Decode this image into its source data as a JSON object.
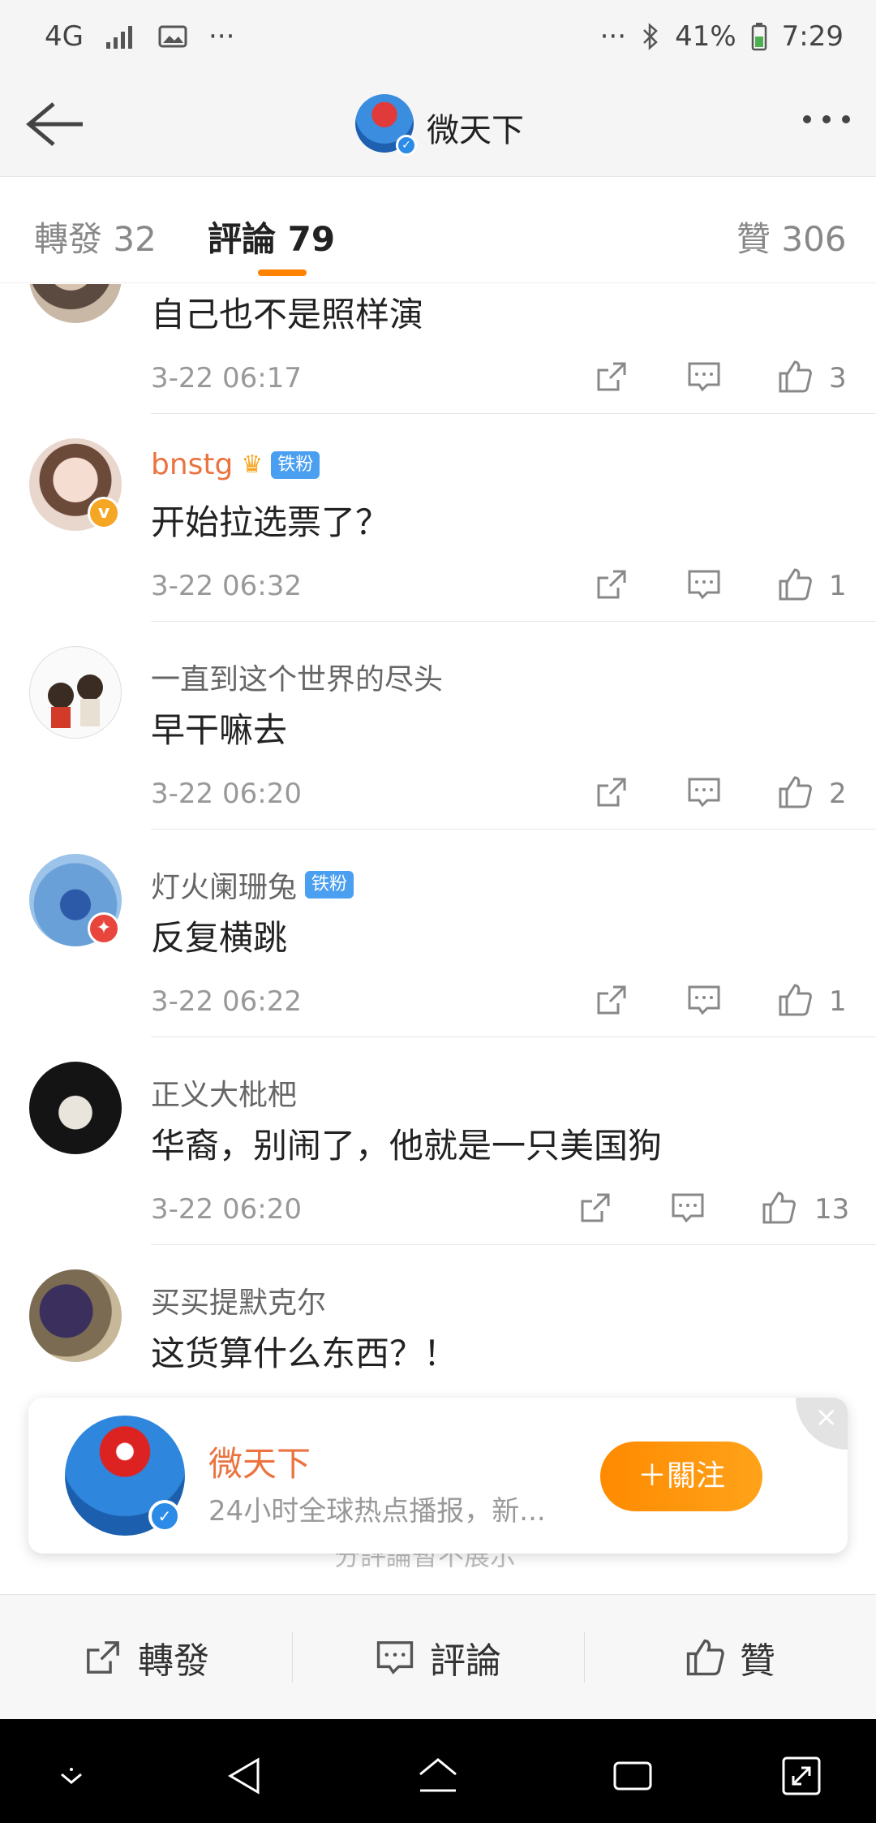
{
  "status_bar": {
    "network": "4G",
    "dots_left": "···",
    "dots_right": "···",
    "battery": "41%",
    "time": "7:29"
  },
  "header": {
    "title": "微天下"
  },
  "tabs": {
    "repost": "轉發 32",
    "comment": "評論 79",
    "like": "贊 306"
  },
  "comments": [
    {
      "user": "",
      "text": "自己也不是照样演",
      "time": "3-22 06:17",
      "likes": "3"
    },
    {
      "user": "bnstg",
      "badge": "铁粉",
      "text": "开始拉选票了？",
      "time": "3-22 06:32",
      "likes": "1"
    },
    {
      "user": "一直到这个世界的尽头",
      "text": "早干嘛去",
      "time": "3-22 06:20",
      "likes": "2"
    },
    {
      "user": "灯火阑珊兔",
      "badge": "铁粉",
      "text": "反复横跳",
      "time": "3-22 06:22",
      "likes": "1"
    },
    {
      "user": "正义大枇杷",
      "text": "华裔，别闹了，他就是一只美国狗",
      "time": "3-22 06:20",
      "likes": "13"
    },
    {
      "user": "买买提默克尔",
      "text": "这货算什么东西？！",
      "time": "",
      "likes": ""
    }
  ],
  "follow_card": {
    "name": "微天下",
    "desc": "24小时全球热点播报，新...",
    "button": "＋關注",
    "close": "×"
  },
  "faint_text": "分評論暫不展示",
  "bottom_bar": {
    "repost": "轉發",
    "comment": "評論",
    "like": "贊"
  },
  "colors": {
    "accent": "#ff8200",
    "username_vip": "#eb7340",
    "badge_blue": "#4a9ff0"
  }
}
